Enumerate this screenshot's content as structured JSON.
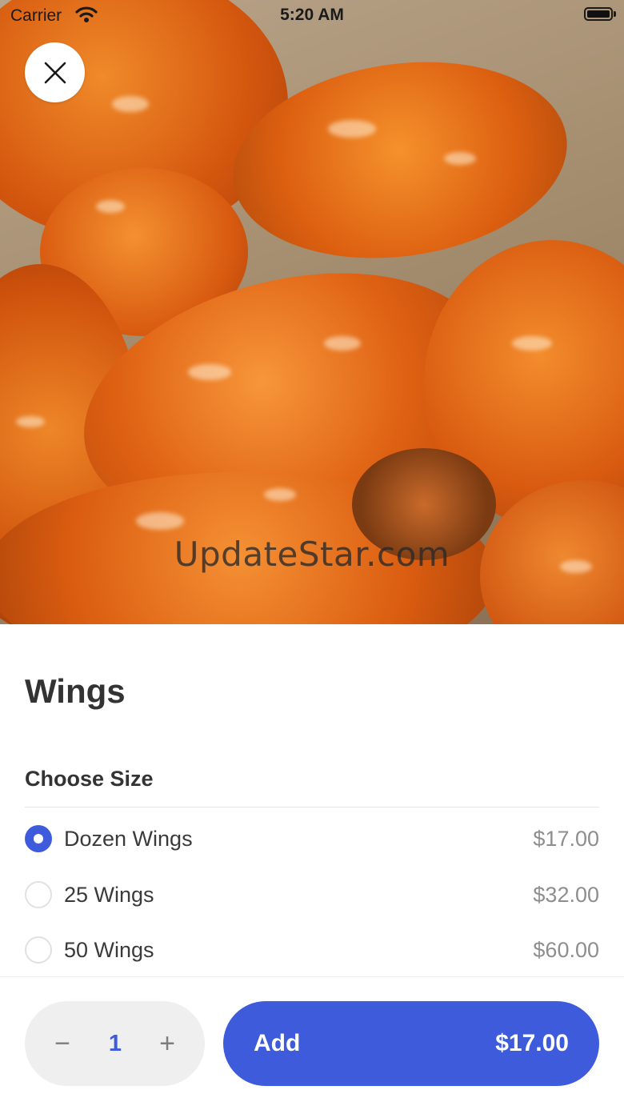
{
  "status_bar": {
    "carrier": "Carrier",
    "time": "5:20 AM",
    "wifi_icon": "wifi-icon",
    "battery_icon": "battery-icon"
  },
  "hero": {
    "image": "chicken wings photo",
    "watermark": "UpdateStar.com"
  },
  "close_icon": "close-icon",
  "item": {
    "title": "Wings"
  },
  "size_section": {
    "title": "Choose Size",
    "options": [
      {
        "label": "Dozen Wings",
        "price": "$17.00",
        "selected": true
      },
      {
        "label": "25 Wings",
        "price": "$32.00",
        "selected": false
      },
      {
        "label": "50 Wings",
        "price": "$60.00",
        "selected": false
      }
    ]
  },
  "quantity": {
    "minus": "−",
    "value": "1",
    "plus": "+"
  },
  "add_button": {
    "label": "Add",
    "price": "$17.00"
  },
  "colors": {
    "accent": "#3e5bdc",
    "stepper_bg": "#efefef",
    "text": "#333333",
    "price_text": "#8e8e8e"
  }
}
